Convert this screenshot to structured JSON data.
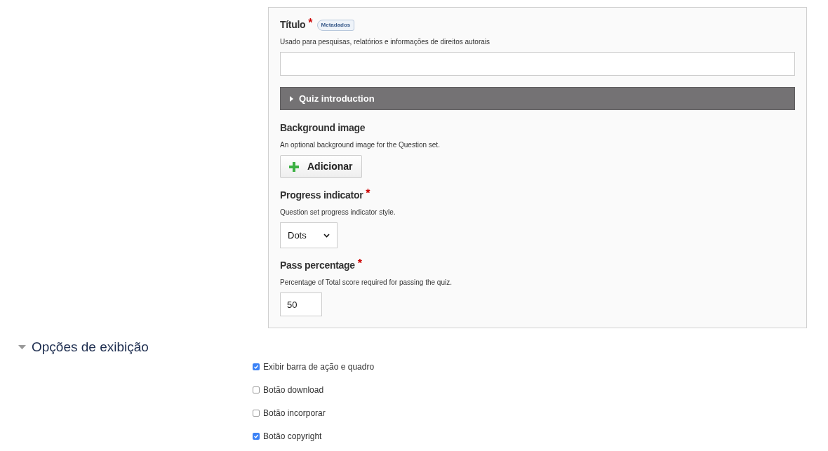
{
  "form_fields": [
    {
      "kind": "text",
      "label": "Título",
      "required_mark": "*",
      "badge": "Metadados",
      "description": "Usado para pesquisas, relatórios e informações de direitos autorais"
    },
    {
      "kind": "group",
      "label": "Quiz introduction",
      "expanded": false
    },
    {
      "kind": "image",
      "label": "Background image",
      "description": "An optional background image for the Question set.",
      "button": "Adicionar"
    },
    {
      "kind": "select",
      "label": "Progress indicator",
      "required_mark": "*",
      "description": "Question set progress indicator style.",
      "value": "Dots"
    },
    {
      "kind": "number",
      "label": "Pass percentage",
      "required_mark": "*",
      "description": "Percentage of Total score required for passing the quiz.",
      "value": "50"
    }
  ],
  "display_options": {
    "title": "Opções de exibição",
    "expanded": true,
    "options": [
      {
        "label": "Exibir barra de ação e quadro",
        "checked": true
      },
      {
        "label": "Botão download",
        "checked": false
      },
      {
        "label": "Botão incorporar",
        "checked": false
      },
      {
        "label": "Botão copyright",
        "checked": true
      }
    ]
  }
}
